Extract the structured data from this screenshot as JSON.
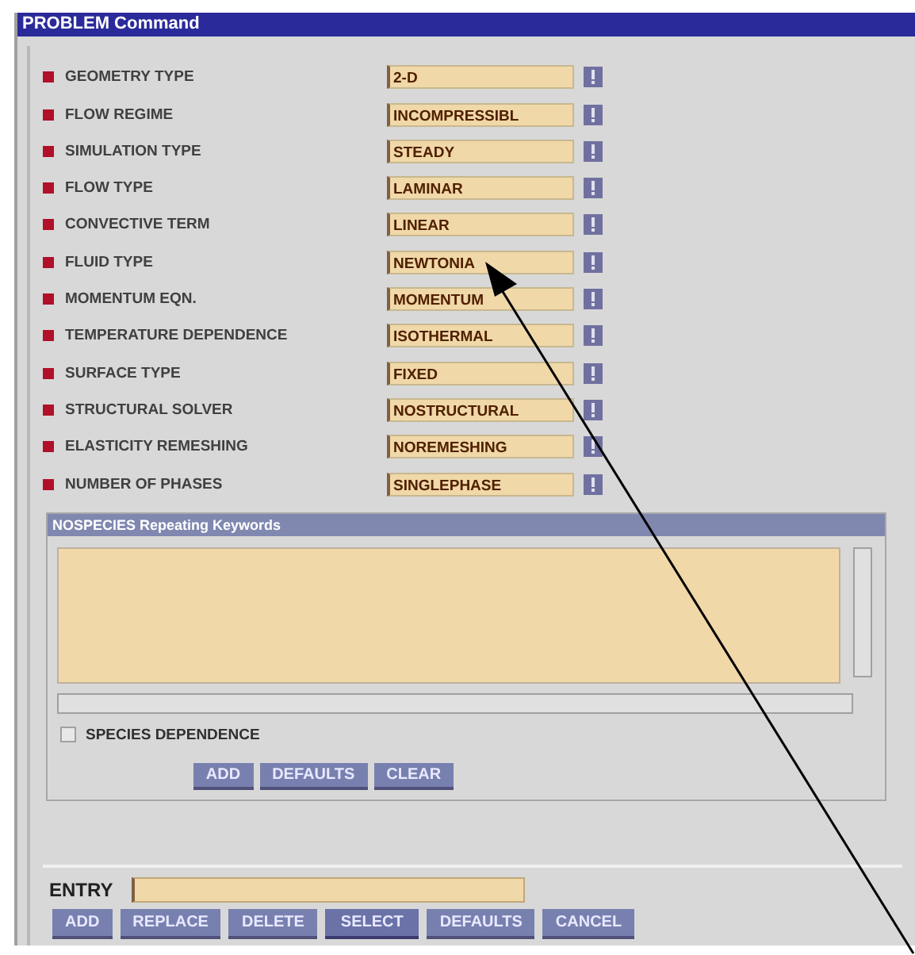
{
  "window": {
    "title": "PROBLEM Command"
  },
  "keywords": [
    {
      "label": "GEOMETRY TYPE",
      "value": "2-D"
    },
    {
      "label": "FLOW REGIME",
      "value": "INCOMPRESSIBL"
    },
    {
      "label": "SIMULATION TYPE",
      "value": "STEADY"
    },
    {
      "label": "FLOW TYPE",
      "value": "LAMINAR"
    },
    {
      "label": "CONVECTIVE TERM",
      "value": "LINEAR"
    },
    {
      "label": "FLUID TYPE",
      "value": "NEWTONIA"
    },
    {
      "label": "MOMENTUM EQN.",
      "value": "MOMENTUM"
    },
    {
      "label": "TEMPERATURE DEPENDENCE",
      "value": "ISOTHERMAL"
    },
    {
      "label": "SURFACE TYPE",
      "value": "FIXED"
    },
    {
      "label": "STRUCTURAL SOLVER",
      "value": "NOSTRUCTURAL"
    },
    {
      "label": "ELASTICITY REMESHING",
      "value": "NOREMESHING"
    },
    {
      "label": "NUMBER OF PHASES",
      "value": "SINGLEPHASE"
    }
  ],
  "repeating": {
    "title": "NOSPECIES Repeating Keywords",
    "checkbox": {
      "label": "SPECIES DEPENDENCE",
      "checked": false
    },
    "buttons": [
      "ADD",
      "DEFAULTS",
      "CLEAR"
    ]
  },
  "entry": {
    "label": "ENTRY"
  },
  "buttons": [
    {
      "label": "ADD",
      "selected": false
    },
    {
      "label": "REPLACE",
      "selected": false
    },
    {
      "label": "DELETE",
      "selected": false
    },
    {
      "label": "SELECT",
      "selected": true
    },
    {
      "label": "DEFAULTS",
      "selected": false
    },
    {
      "label": "CANCEL",
      "selected": false
    }
  ]
}
